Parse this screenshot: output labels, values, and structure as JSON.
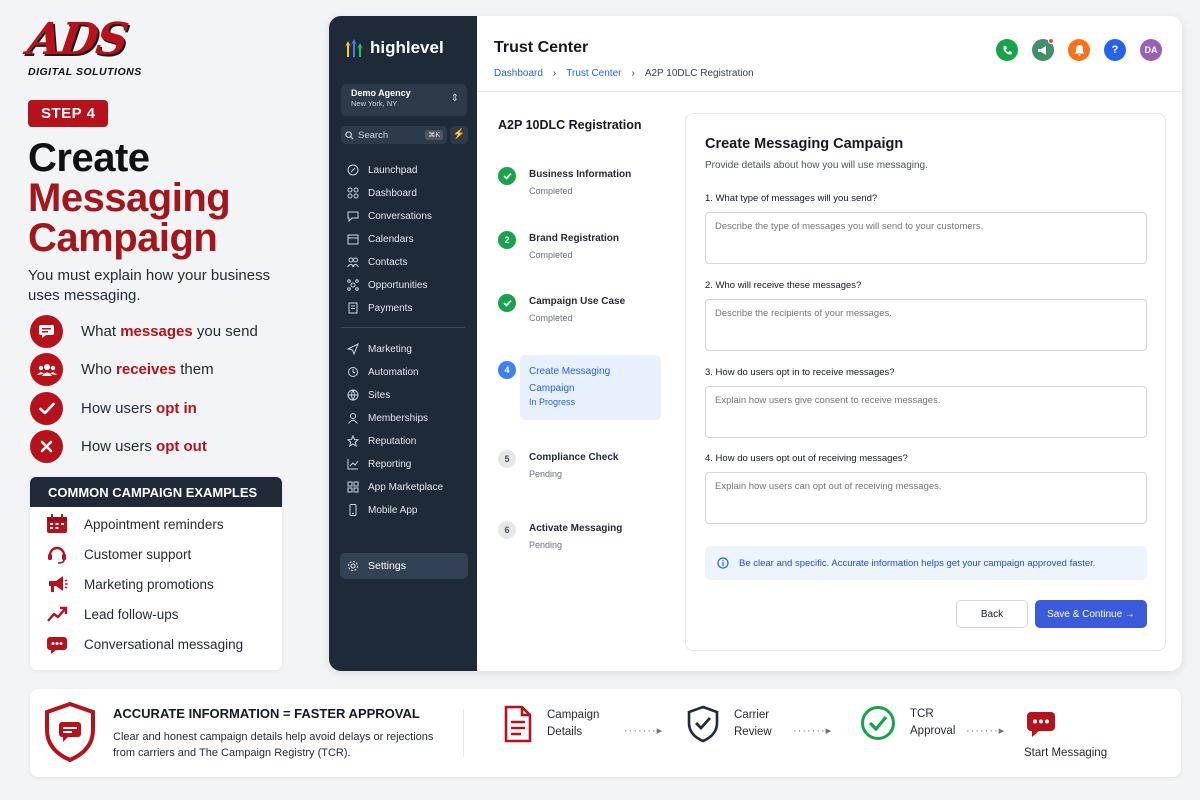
{
  "brand": {
    "logo_mark": "ADS",
    "logo_sub": "DIGITAL SOLUTIONS",
    "accent": "#b5121b"
  },
  "hero": {
    "step_badge": "STEP 4",
    "title_line1": "Create",
    "title_line2": "Messaging",
    "title_line3": "Campaign",
    "intro": "You must explain how your business uses messaging.",
    "features": [
      {
        "pre": "What ",
        "em": "messages",
        "post": " you send",
        "icon": "message-icon"
      },
      {
        "pre": "Who ",
        "em": "receives",
        "post": " them",
        "icon": "users-icon"
      },
      {
        "pre": "How users ",
        "em": "opt in",
        "post": "",
        "icon": "check-icon"
      },
      {
        "pre": "How users ",
        "em": "opt out",
        "post": "",
        "icon": "x-icon"
      }
    ]
  },
  "examples": {
    "heading": "COMMON CAMPAIGN EXAMPLES",
    "items": [
      "Appointment reminders",
      "Customer support",
      "Marketing promotions",
      "Lead follow-ups",
      "Conversational messaging"
    ]
  },
  "app": {
    "brand_name": "highlevel",
    "agency_name": "Demo Agency",
    "agency_location": "New York, NY",
    "search_label": "Search",
    "search_shortcut": "⌘K",
    "nav_top": [
      "Launchpad",
      "Dashboard",
      "Conversations",
      "Calendars",
      "Contacts",
      "Opportunities",
      "Payments"
    ],
    "nav_bottom": [
      "Marketing",
      "Automation",
      "Sites",
      "Memberships",
      "Reputation",
      "Reporting",
      "App Marketplace",
      "Mobile App"
    ],
    "settings_label": "Settings",
    "page_title": "Trust Center",
    "breadcrumb": [
      "Dashboard",
      "Trust Center",
      "A2P 10DLC Registration"
    ],
    "avatar_initials": "DA",
    "header_colors": {
      "phone": "#16a34a",
      "megaphone": "#3f8f6b",
      "bell": "#f97316",
      "help": "#2563eb",
      "avatar": "#9b5fb5"
    }
  },
  "wizard": {
    "title": "A2P 10DLC Registration",
    "steps": [
      {
        "n": "1",
        "label": "Business Information",
        "status": "Completed",
        "state": "done"
      },
      {
        "n": "2",
        "label": "Brand Registration",
        "status": "Completed",
        "state": "done-num"
      },
      {
        "n": "3",
        "label": "Campaign Use Case",
        "status": "Completed",
        "state": "done"
      },
      {
        "n": "4",
        "label_line1": "Create Messaging",
        "label_line2": "Campaign",
        "status": "In Progress",
        "state": "active"
      },
      {
        "n": "5",
        "label": "Compliance Check",
        "status": "Pending",
        "state": "pending"
      },
      {
        "n": "6",
        "label": "Activate Messaging",
        "status": "Pending",
        "state": "pending"
      }
    ]
  },
  "form": {
    "title": "Create Messaging Campaign",
    "subtitle": "Provide details about how you will use messaging.",
    "questions": [
      {
        "label": "1. What type of messages will you send?",
        "placeholder": "Describe the type of messages you will send to your customers."
      },
      {
        "label": "2. Who will receive these messages?",
        "placeholder": "Describe the recipients of your messages."
      },
      {
        "label": "3. How do users opt in to receive messages?",
        "placeholder": "Explain how users give consent to receive messages."
      },
      {
        "label": "4. How do users opt out of receiving messages?",
        "placeholder": "Explain how users can opt out of receiving messages."
      }
    ],
    "tip": "Be clear and specific. Accurate information helps get your campaign approved faster.",
    "back_label": "Back",
    "save_label": "Save & Continue"
  },
  "banner": {
    "title": "ACCURATE INFORMATION = FASTER APPROVAL",
    "body": "Clear and honest campaign details help avoid delays or rejections from carriers and The Campaign Registry (TCR).",
    "flow": [
      {
        "line1": "Campaign",
        "line2": "Details",
        "icon": "document-icon"
      },
      {
        "line1": "Carrier",
        "line2": "Review",
        "icon": "shield-check-icon"
      },
      {
        "line1": "TCR",
        "line2": "Approval",
        "icon": "check-circle-icon"
      },
      {
        "line1": "Start Messaging",
        "line2": "",
        "icon": "chat-bubble-icon"
      }
    ]
  }
}
